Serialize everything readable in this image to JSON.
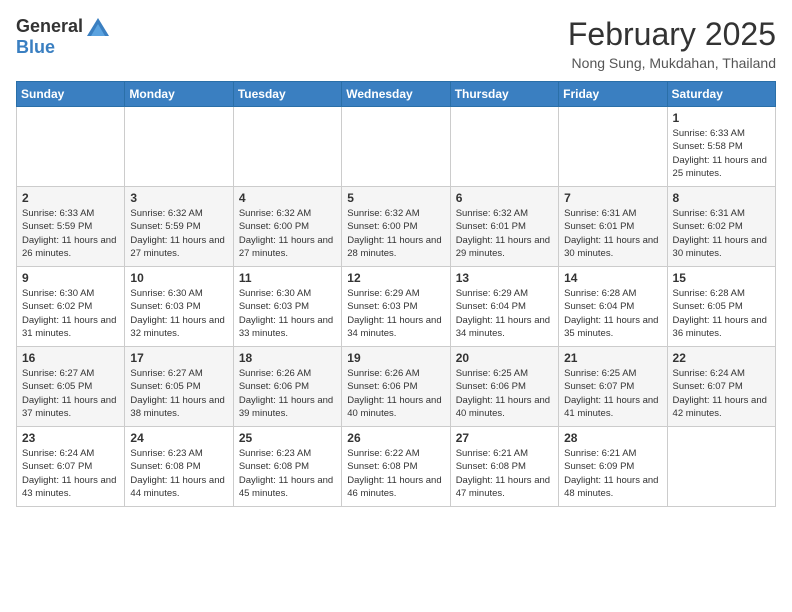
{
  "header": {
    "logo": {
      "general": "General",
      "blue": "Blue"
    },
    "title": "February 2025",
    "location": "Nong Sung, Mukdahan, Thailand"
  },
  "calendar": {
    "weekdays": [
      "Sunday",
      "Monday",
      "Tuesday",
      "Wednesday",
      "Thursday",
      "Friday",
      "Saturday"
    ],
    "weeks": [
      [
        {
          "day": "",
          "info": ""
        },
        {
          "day": "",
          "info": ""
        },
        {
          "day": "",
          "info": ""
        },
        {
          "day": "",
          "info": ""
        },
        {
          "day": "",
          "info": ""
        },
        {
          "day": "",
          "info": ""
        },
        {
          "day": "1",
          "info": "Sunrise: 6:33 AM\nSunset: 5:58 PM\nDaylight: 11 hours and 25 minutes."
        }
      ],
      [
        {
          "day": "2",
          "info": "Sunrise: 6:33 AM\nSunset: 5:59 PM\nDaylight: 11 hours and 26 minutes."
        },
        {
          "day": "3",
          "info": "Sunrise: 6:32 AM\nSunset: 5:59 PM\nDaylight: 11 hours and 27 minutes."
        },
        {
          "day": "4",
          "info": "Sunrise: 6:32 AM\nSunset: 6:00 PM\nDaylight: 11 hours and 27 minutes."
        },
        {
          "day": "5",
          "info": "Sunrise: 6:32 AM\nSunset: 6:00 PM\nDaylight: 11 hours and 28 minutes."
        },
        {
          "day": "6",
          "info": "Sunrise: 6:32 AM\nSunset: 6:01 PM\nDaylight: 11 hours and 29 minutes."
        },
        {
          "day": "7",
          "info": "Sunrise: 6:31 AM\nSunset: 6:01 PM\nDaylight: 11 hours and 30 minutes."
        },
        {
          "day": "8",
          "info": "Sunrise: 6:31 AM\nSunset: 6:02 PM\nDaylight: 11 hours and 30 minutes."
        }
      ],
      [
        {
          "day": "9",
          "info": "Sunrise: 6:30 AM\nSunset: 6:02 PM\nDaylight: 11 hours and 31 minutes."
        },
        {
          "day": "10",
          "info": "Sunrise: 6:30 AM\nSunset: 6:03 PM\nDaylight: 11 hours and 32 minutes."
        },
        {
          "day": "11",
          "info": "Sunrise: 6:30 AM\nSunset: 6:03 PM\nDaylight: 11 hours and 33 minutes."
        },
        {
          "day": "12",
          "info": "Sunrise: 6:29 AM\nSunset: 6:03 PM\nDaylight: 11 hours and 34 minutes."
        },
        {
          "day": "13",
          "info": "Sunrise: 6:29 AM\nSunset: 6:04 PM\nDaylight: 11 hours and 34 minutes."
        },
        {
          "day": "14",
          "info": "Sunrise: 6:28 AM\nSunset: 6:04 PM\nDaylight: 11 hours and 35 minutes."
        },
        {
          "day": "15",
          "info": "Sunrise: 6:28 AM\nSunset: 6:05 PM\nDaylight: 11 hours and 36 minutes."
        }
      ],
      [
        {
          "day": "16",
          "info": "Sunrise: 6:27 AM\nSunset: 6:05 PM\nDaylight: 11 hours and 37 minutes."
        },
        {
          "day": "17",
          "info": "Sunrise: 6:27 AM\nSunset: 6:05 PM\nDaylight: 11 hours and 38 minutes."
        },
        {
          "day": "18",
          "info": "Sunrise: 6:26 AM\nSunset: 6:06 PM\nDaylight: 11 hours and 39 minutes."
        },
        {
          "day": "19",
          "info": "Sunrise: 6:26 AM\nSunset: 6:06 PM\nDaylight: 11 hours and 40 minutes."
        },
        {
          "day": "20",
          "info": "Sunrise: 6:25 AM\nSunset: 6:06 PM\nDaylight: 11 hours and 40 minutes."
        },
        {
          "day": "21",
          "info": "Sunrise: 6:25 AM\nSunset: 6:07 PM\nDaylight: 11 hours and 41 minutes."
        },
        {
          "day": "22",
          "info": "Sunrise: 6:24 AM\nSunset: 6:07 PM\nDaylight: 11 hours and 42 minutes."
        }
      ],
      [
        {
          "day": "23",
          "info": "Sunrise: 6:24 AM\nSunset: 6:07 PM\nDaylight: 11 hours and 43 minutes."
        },
        {
          "day": "24",
          "info": "Sunrise: 6:23 AM\nSunset: 6:08 PM\nDaylight: 11 hours and 44 minutes."
        },
        {
          "day": "25",
          "info": "Sunrise: 6:23 AM\nSunset: 6:08 PM\nDaylight: 11 hours and 45 minutes."
        },
        {
          "day": "26",
          "info": "Sunrise: 6:22 AM\nSunset: 6:08 PM\nDaylight: 11 hours and 46 minutes."
        },
        {
          "day": "27",
          "info": "Sunrise: 6:21 AM\nSunset: 6:08 PM\nDaylight: 11 hours and 47 minutes."
        },
        {
          "day": "28",
          "info": "Sunrise: 6:21 AM\nSunset: 6:09 PM\nDaylight: 11 hours and 48 minutes."
        },
        {
          "day": "",
          "info": ""
        }
      ]
    ]
  }
}
